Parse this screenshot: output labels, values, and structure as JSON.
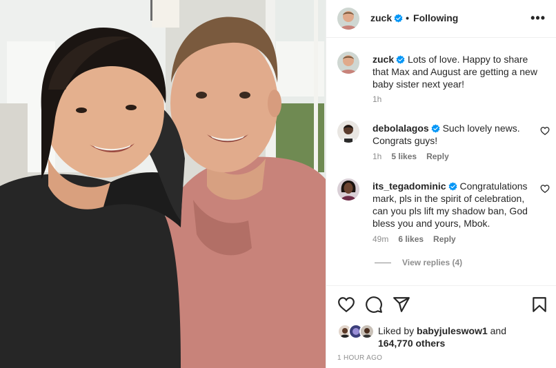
{
  "post": {
    "author": "zuck",
    "follow_state": "Following",
    "separator": "•",
    "more_icon": "more-horizontal-icon",
    "more_glyph": "•••"
  },
  "caption": {
    "username": "zuck",
    "text": "Lots of love. Happy to share that Max and August are getting a new baby sister next year!",
    "time": "1h"
  },
  "comments": [
    {
      "username": "debolalagos",
      "text": "Such lovely news. Congrats guys!",
      "time": "1h",
      "likes": "5 likes",
      "reply": "Reply"
    },
    {
      "username": "its_tegadominic",
      "text": "Congratulations mark, pls in the spirit of celebration, can you pls lift my shadow ban, God bless you and yours, Mbok.",
      "time": "49m",
      "likes": "6 likes",
      "reply": "Reply",
      "view_replies": "View replies (4)"
    }
  ],
  "likes": {
    "prefix": "Liked by",
    "user": "babyjuleswow1",
    "and": "and",
    "count": "164,770 others"
  },
  "timestamp": "1 HOUR AGO",
  "colors": {
    "verified": "#0095f6",
    "text": "#262626",
    "muted": "#8e8e8e",
    "divider": "#efefef"
  }
}
